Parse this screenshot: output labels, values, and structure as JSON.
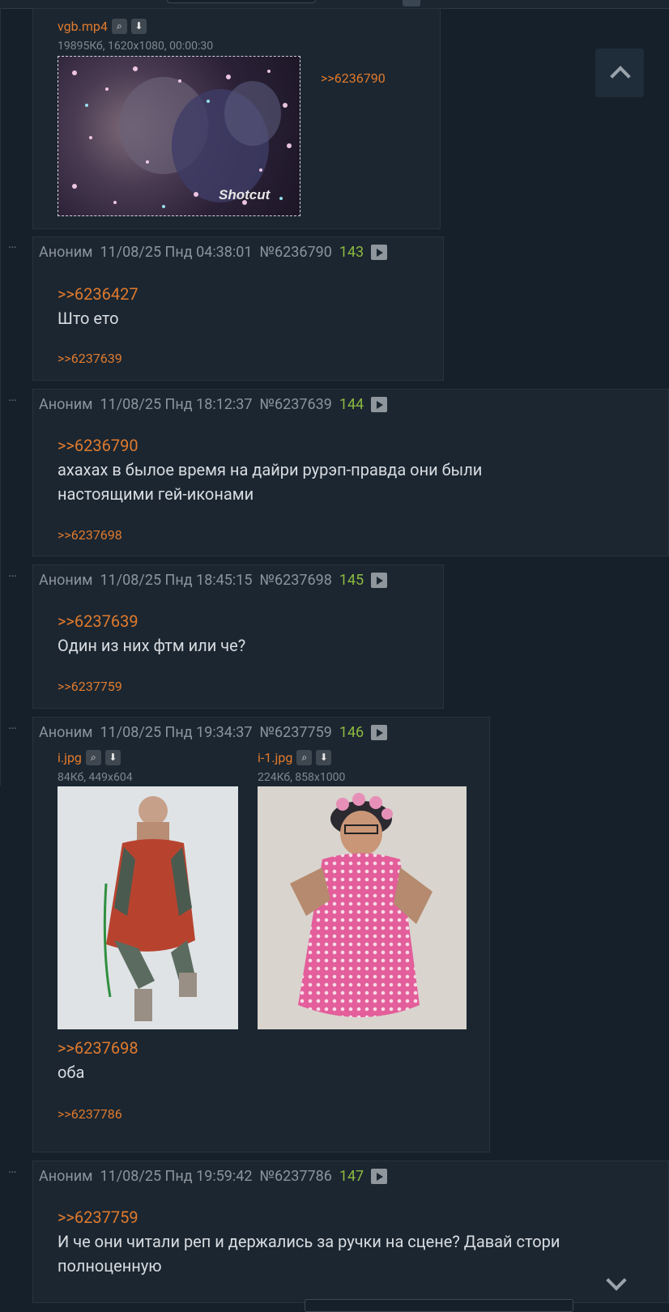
{
  "colors": {
    "accent": "#e07a2c",
    "count": "#8bb83f",
    "background": "#16202a",
    "post_bg": "#1b2631"
  },
  "top_post": {
    "file": {
      "name": "vgb.mp4",
      "info": "19895Кб, 1620x1080, 00:00:30",
      "icons": [
        "search-icon",
        "download-icon"
      ]
    },
    "backlink": ">>6236790"
  },
  "posts": [
    {
      "author": "Аноним",
      "date": "11/08/25 Пнд 04:38:01",
      "num": "№6236790",
      "count": "143",
      "reply": ">>6236427",
      "text": "Што ето",
      "backlink": ">>6237639"
    },
    {
      "author": "Аноним",
      "date": "11/08/25 Пнд 18:12:37",
      "num": "№6237639",
      "count": "144",
      "reply": ">>6236790",
      "text_lines": [
        "ахахах в былое время на дайри рурэп-правда они были",
        "настоящими гей-иконами"
      ],
      "backlink": ">>6237698"
    },
    {
      "author": "Аноним",
      "date": "11/08/25 Пнд 18:45:15",
      "num": "№6237698",
      "count": "145",
      "reply": ">>6237639",
      "text": "Один из них фтм или че?",
      "backlink": ">>6237759"
    },
    {
      "author": "Аноним",
      "date": "11/08/25 Пнд 19:34:37",
      "num": "№6237759",
      "count": "146",
      "files": [
        {
          "name": "i.jpg",
          "info": "84Кб, 449x604"
        },
        {
          "name": "i-1.jpg",
          "info": "224Кб, 858x1000"
        }
      ],
      "reply": ">>6237698",
      "text": "оба",
      "backlink": ">>6237786"
    },
    {
      "author": "Аноним",
      "date": "11/08/25 Пнд 19:59:42",
      "num": "№6237786",
      "count": "147",
      "reply": ">>6237759",
      "text_lines": [
        "И че они читали реп и держались за ручки на сцене? Давай стори",
        "полноценную"
      ]
    }
  ],
  "watermark": "Shotcut"
}
